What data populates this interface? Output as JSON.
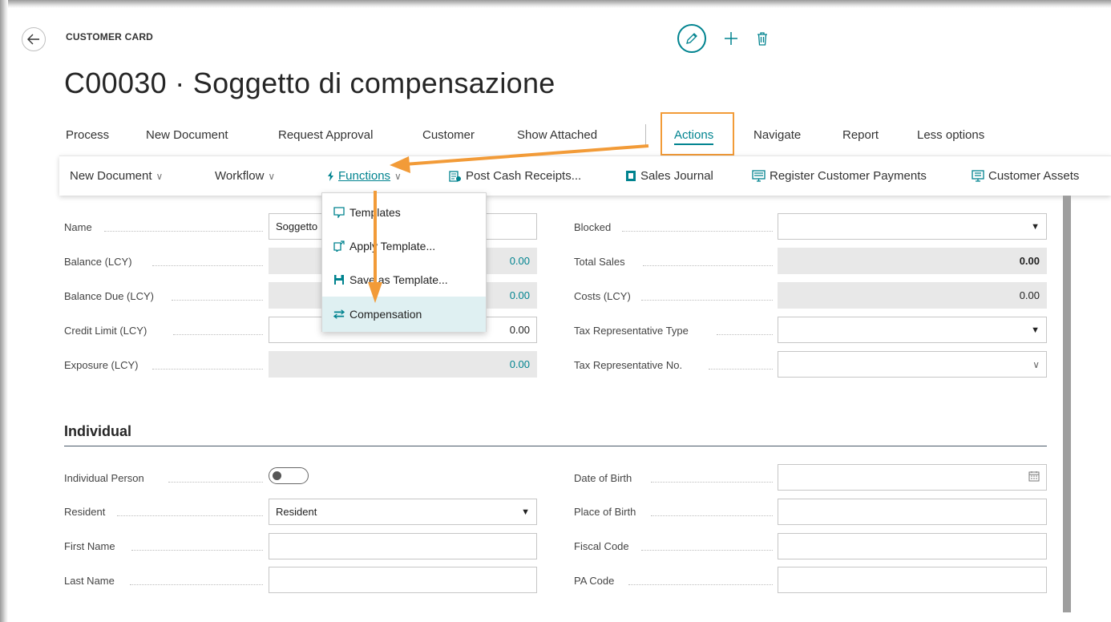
{
  "header": {
    "caption": "CUSTOMER CARD",
    "title": "C00030 · Soggetto di compensazione"
  },
  "icons": {
    "back": "back-arrow-icon",
    "edit": "pencil-icon",
    "new": "plus-icon",
    "delete": "trash-icon"
  },
  "colors": {
    "accent": "#00838f",
    "highlight": "#f29b38",
    "readonly_field": "#e8e8e8"
  },
  "action_bar": {
    "items": [
      "Process",
      "New Document",
      "Request Approval",
      "Customer",
      "Show Attached",
      "Actions",
      "Navigate",
      "Report",
      "Less options"
    ]
  },
  "sub_bar": {
    "new_document": "New Document",
    "workflow": "Workflow",
    "functions": "Functions",
    "post_cash_receipts": "Post Cash Receipts...",
    "sales_journal": "Sales Journal",
    "register_payments": "Register Customer Payments",
    "customer_assets": "Customer Assets"
  },
  "functions_menu": {
    "items": [
      "Templates",
      "Apply Template...",
      "Save as Template...",
      "Compensation"
    ]
  },
  "general": {
    "name_label": "Name",
    "name_value": "Soggetto",
    "balance_label": "Balance (LCY)",
    "balance_value": "0.00",
    "balance_due_label": "Balance Due (LCY)",
    "balance_due_value": "0.00",
    "credit_limit_label": "Credit Limit (LCY)",
    "credit_limit_value": "0.00",
    "exposure_label": "Exposure (LCY)",
    "exposure_value": "0.00",
    "blocked_label": "Blocked",
    "blocked_value": "",
    "total_sales_label": "Total Sales",
    "total_sales_value": "0.00",
    "costs_label": "Costs (LCY)",
    "costs_value": "0.00",
    "tax_rep_type_label": "Tax Representative Type",
    "tax_rep_type_value": "",
    "tax_rep_no_label": "Tax Representative No.",
    "tax_rep_no_value": ""
  },
  "individual": {
    "title": "Individual",
    "person_label": "Individual Person",
    "person_on": false,
    "resident_label": "Resident",
    "resident_value": "Resident",
    "first_name_label": "First Name",
    "first_name_value": "",
    "last_name_label": "Last Name",
    "last_name_value": "",
    "dob_label": "Date of Birth",
    "dob_value": "",
    "pob_label": "Place of Birth",
    "pob_value": "",
    "fiscal_code_label": "Fiscal Code",
    "fiscal_code_value": "",
    "pa_code_label": "PA Code",
    "pa_code_value": ""
  }
}
